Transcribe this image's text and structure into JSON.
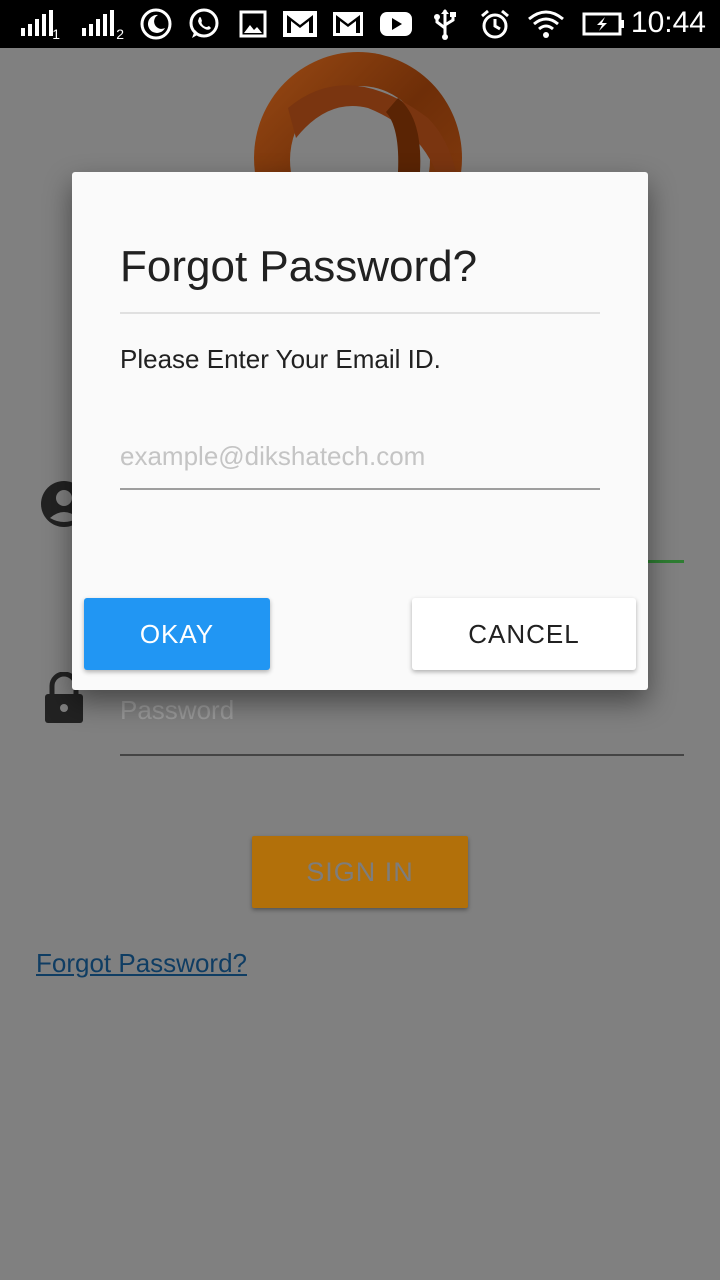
{
  "status_bar": {
    "sim1": "1",
    "sim2": "2",
    "time": "10:44",
    "icons": [
      "signal-icon",
      "signal-icon",
      "night-mode-icon",
      "whatsapp-icon",
      "image-icon",
      "gmail-icon",
      "gmail-icon",
      "youtube-icon",
      "usb-icon",
      "alarm-icon",
      "wifi-icon",
      "battery-charging-icon"
    ]
  },
  "background": {
    "password_placeholder": "Password",
    "sign_in_label": "SIGN IN",
    "forgot_link": "Forgot Password?"
  },
  "dialog": {
    "title": "Forgot Password?",
    "message": "Please Enter Your Email ID.",
    "email_placeholder": "example@dikshatech.com",
    "okay_label": "OKAY",
    "cancel_label": "CANCEL"
  },
  "colors": {
    "scrim": "#808080",
    "okay_button": "#2196f3",
    "sign_in_button": "#b2700a",
    "link": "#0f3d63",
    "accent_line": "#2e7d32"
  }
}
